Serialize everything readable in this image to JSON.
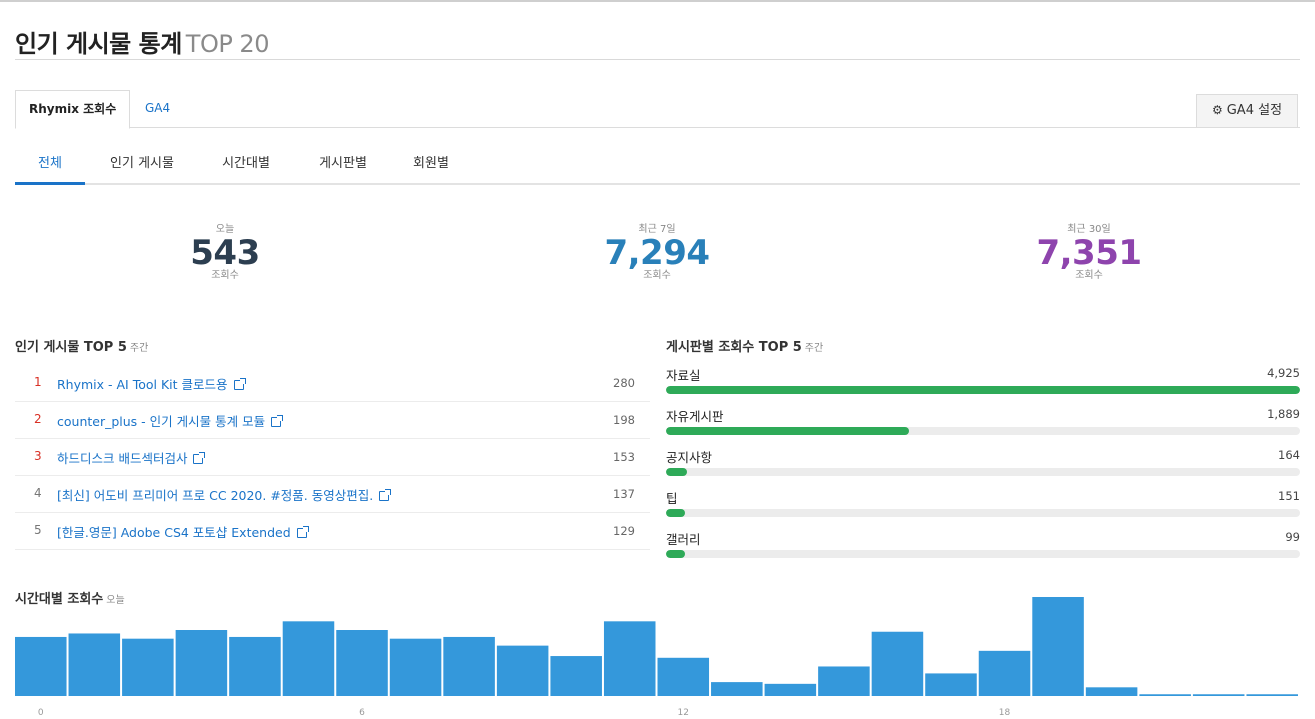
{
  "header": {
    "title": "인기 게시물 통계",
    "subtitle": "TOP 20"
  },
  "top_tabs": [
    {
      "label": "Rhymix 조회수"
    },
    {
      "label": "GA4"
    }
  ],
  "ga4_button": {
    "icon": "gear-icon",
    "label": "GA4 설정"
  },
  "sub_tabs": [
    {
      "label": "전체"
    },
    {
      "label": "인기 게시물"
    },
    {
      "label": "시간대별"
    },
    {
      "label": "게시판별"
    },
    {
      "label": "회원별"
    }
  ],
  "stats": [
    {
      "label": "오늘",
      "value": "543",
      "unit": "조회수",
      "color": "#2c3e50"
    },
    {
      "label": "최근 7일",
      "value": "7,294",
      "unit": "조회수",
      "color": "#2980b9"
    },
    {
      "label": "최근 30일",
      "value": "7,351",
      "unit": "조회수",
      "color": "#8e44ad"
    }
  ],
  "popular_posts": {
    "title": "인기 게시물 TOP 5",
    "period": "주간",
    "items": [
      {
        "rank": "1",
        "title": "Rhymix - AI Tool Kit 클로드용",
        "count": "280"
      },
      {
        "rank": "2",
        "title": "counter_plus - 인기 게시물 통계 모듈",
        "count": "198"
      },
      {
        "rank": "3",
        "title": "하드디스크 배드섹터검사",
        "count": "153"
      },
      {
        "rank": "4",
        "title": "[최신] 어도비 프리미어 프로 CC 2020. #정품. 동영상편집.",
        "count": "137"
      },
      {
        "rank": "5",
        "title": "[한글.영문] Adobe CS4 포토샵 Extended",
        "count": "129"
      }
    ]
  },
  "board_views": {
    "title": "게시판별 조회수 TOP 5",
    "period": "주간",
    "max": 4925,
    "bar_color": "#2eaa58",
    "items": [
      {
        "name": "자료실",
        "value": 4925,
        "label": "4,925"
      },
      {
        "name": "자유게시판",
        "value": 1889,
        "label": "1,889"
      },
      {
        "name": "공지사항",
        "value": 164,
        "label": "164"
      },
      {
        "name": "팁",
        "value": 151,
        "label": "151"
      },
      {
        "name": "갤러리",
        "value": 99,
        "label": "99"
      }
    ]
  },
  "hourly": {
    "title": "시간대별 조회수",
    "period": "오늘",
    "chart_data": {
      "type": "bar",
      "x": [
        0,
        1,
        2,
        3,
        4,
        5,
        6,
        7,
        8,
        9,
        10,
        11,
        12,
        13,
        14,
        15,
        16,
        17,
        18,
        19,
        20,
        21,
        22,
        23
      ],
      "x_tick_labels": [
        "0",
        "6",
        "12",
        "18"
      ],
      "x_tick_positions": [
        0,
        6,
        12,
        18
      ],
      "values": [
        34,
        36,
        33,
        38,
        34,
        43,
        38,
        33,
        34,
        29,
        23,
        43,
        22,
        8,
        7,
        17,
        37,
        13,
        26,
        57,
        5,
        1,
        1,
        1
      ],
      "ymax": 57,
      "bar_color": "#3498db",
      "grid": false,
      "xlabel": "",
      "ylabel": ""
    }
  }
}
